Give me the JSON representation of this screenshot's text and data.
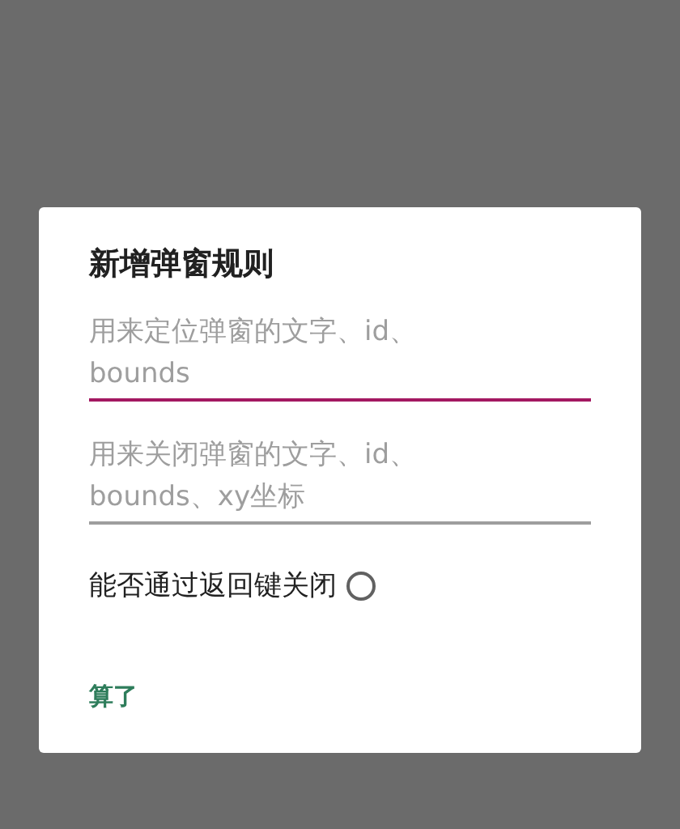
{
  "dialog": {
    "title": "新增弹窗规则",
    "fields": [
      {
        "placeholder": "用来定位弹窗的文字、id、\nbounds",
        "focused": true
      },
      {
        "placeholder": "用来关闭弹窗的文字、id、\nbounds、xy坐标",
        "focused": false
      }
    ],
    "back_key_option": {
      "label": "能否通过返回键关闭",
      "checked": false
    },
    "buttons": [
      "算了"
    ]
  }
}
